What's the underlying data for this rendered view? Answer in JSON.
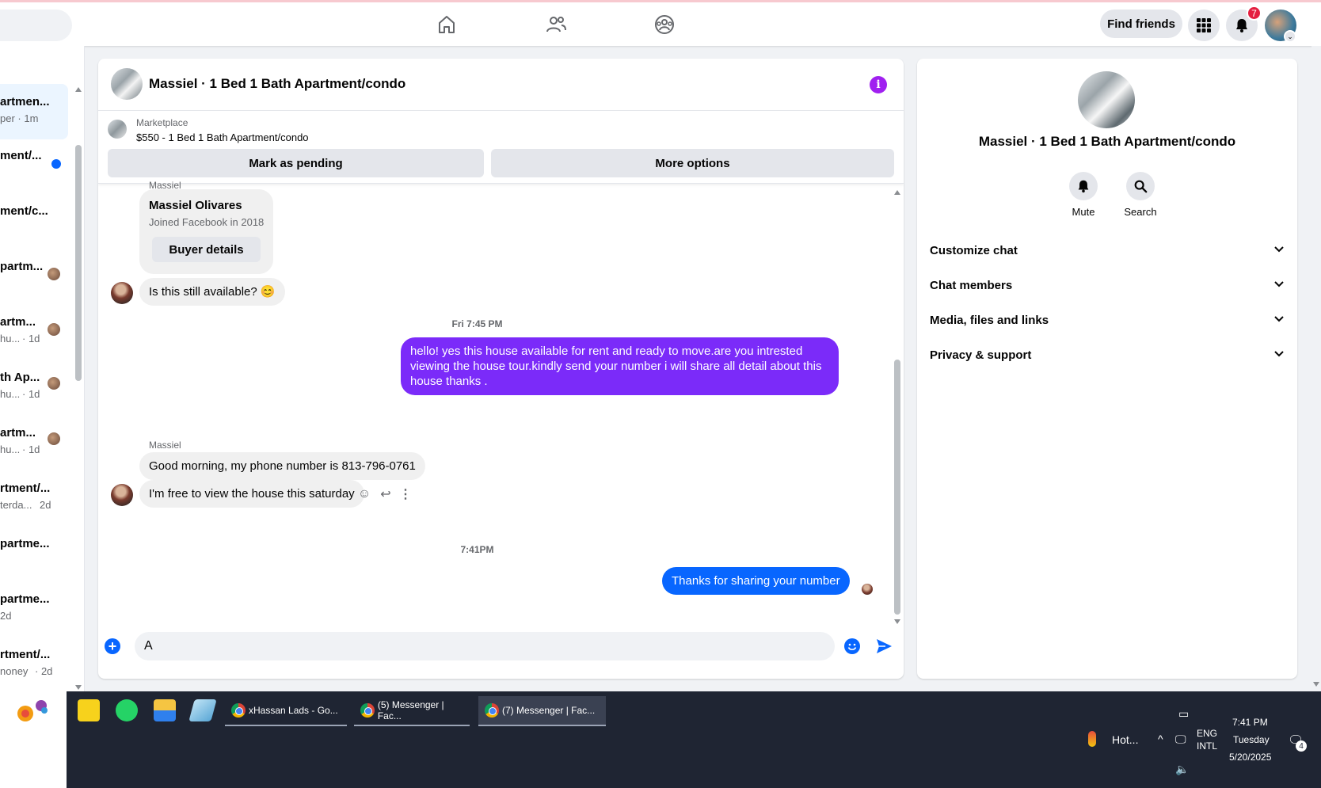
{
  "nav": {
    "find_friends": "Find friends",
    "notification_count": "7",
    "icons": [
      "home-icon",
      "friends-icon",
      "groups-icon",
      "menu-grid-icon",
      "bell-icon"
    ]
  },
  "chat_list": [
    {
      "title": "artmen...",
      "sub": "per · 1m",
      "active": true
    },
    {
      "title": "ment/...",
      "sub": "",
      "unread": true
    },
    {
      "title": "ment/c...",
      "sub": ""
    },
    {
      "title": "partm...",
      "sub": ""
    },
    {
      "title": "artm...",
      "sub": "hu...",
      "time": "· 1d"
    },
    {
      "title": "th Ap...",
      "sub": "hu...",
      "time": "· 1d"
    },
    {
      "title": "artm...",
      "sub": "hu...",
      "time": "· 1d"
    },
    {
      "title": "rtment/...",
      "sub": "terda...",
      "time": "2d"
    },
    {
      "title": "partme...",
      "sub": ""
    },
    {
      "title": "partme...",
      "sub": "2d"
    },
    {
      "title": "rtment/...",
      "sub": "noney",
      "time": "· 2d"
    }
  ],
  "conversation": {
    "title": "Massiel · 1 Bed 1 Bath Apartment/condo",
    "marketplace_label": "Marketplace",
    "listing": "$550 - 1 Bed 1 Bath Apartment/condo",
    "mark_pending": "Mark as pending",
    "more_options": "More options",
    "sender_top": "Massiel",
    "buyer_name": "Massiel Olivares",
    "buyer_joined": "Joined Facebook in 2018",
    "buyer_details": "Buyer details",
    "msg1": "Is this still available? 😊",
    "time1": "Fri 7:45 PM",
    "msg2": "hello! yes this house available for rent and ready to move.are you intrested viewing the house tour.kindly send your number i will share all detail about this house thanks .",
    "sender2": "Massiel",
    "msg3": "Good morning, my phone number is 813-796-0761",
    "msg4": "I'm free to view the house this saturday",
    "time2": "7:41PM",
    "msg5": "Thanks for sharing your number",
    "composer_value": "A"
  },
  "info_panel": {
    "title": "Massiel · 1 Bed 1 Bath Apartment/condo",
    "mute": "Mute",
    "search": "Search",
    "sections": [
      "Customize chat",
      "Chat members",
      "Media, files and links",
      "Privacy & support"
    ]
  },
  "taskbar": {
    "tasks": [
      "xHassan Lads - Go...",
      "(5) Messenger | Fac...",
      "(7) Messenger | Fac..."
    ],
    "weather": "Hot...",
    "lang1": "ENG",
    "lang2": "INTL",
    "time": "7:41 PM",
    "day": "Tuesday",
    "date": "5/20/2025",
    "notif": "4"
  },
  "colors": {
    "accent": "#0866ff",
    "purple_bubble": "#7b2bf9",
    "badge": "#e41e3f"
  }
}
